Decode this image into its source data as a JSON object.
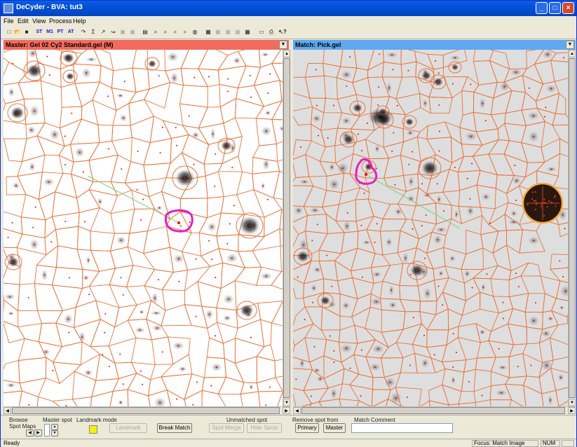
{
  "window": {
    "title": "DeCyder - BVA: tut3"
  },
  "menu": [
    "File",
    "Edit",
    "View",
    "Process",
    "Help"
  ],
  "toolbar": {
    "text_buttons": [
      "ST",
      "M1",
      "PT",
      "AT"
    ]
  },
  "master_panel": {
    "header": "Master: Gel 02 Cy2 Standard.gel (M)",
    "color": "#f26b5f"
  },
  "match_panel": {
    "header": "Match: Pick.gel",
    "color": "#5ea8f0"
  },
  "colors": {
    "boundary": "#e8743c",
    "selected": "#e020c0",
    "match_line": "#7ad27a",
    "spot_center": "#e01010"
  },
  "bottom": {
    "browse_label": "Browse",
    "spot_maps_label": "Spot Maps",
    "master_spot_label": "Master spot",
    "landmark_label": "Landmark mode",
    "set_landmark": "Landmark",
    "break_match": "Break Match",
    "unmatched_label": "Unmatched spot",
    "unmatched_btn1": "Spot Merge",
    "unmatched_btn2": "Hide Spots",
    "remove_label": "Remove spot from",
    "primary": "Primary",
    "master": "Master",
    "match_comment_label": "Match Comment"
  },
  "status": {
    "ready": "Ready",
    "focus": "Focus: Match Image",
    "num": "NUM"
  }
}
